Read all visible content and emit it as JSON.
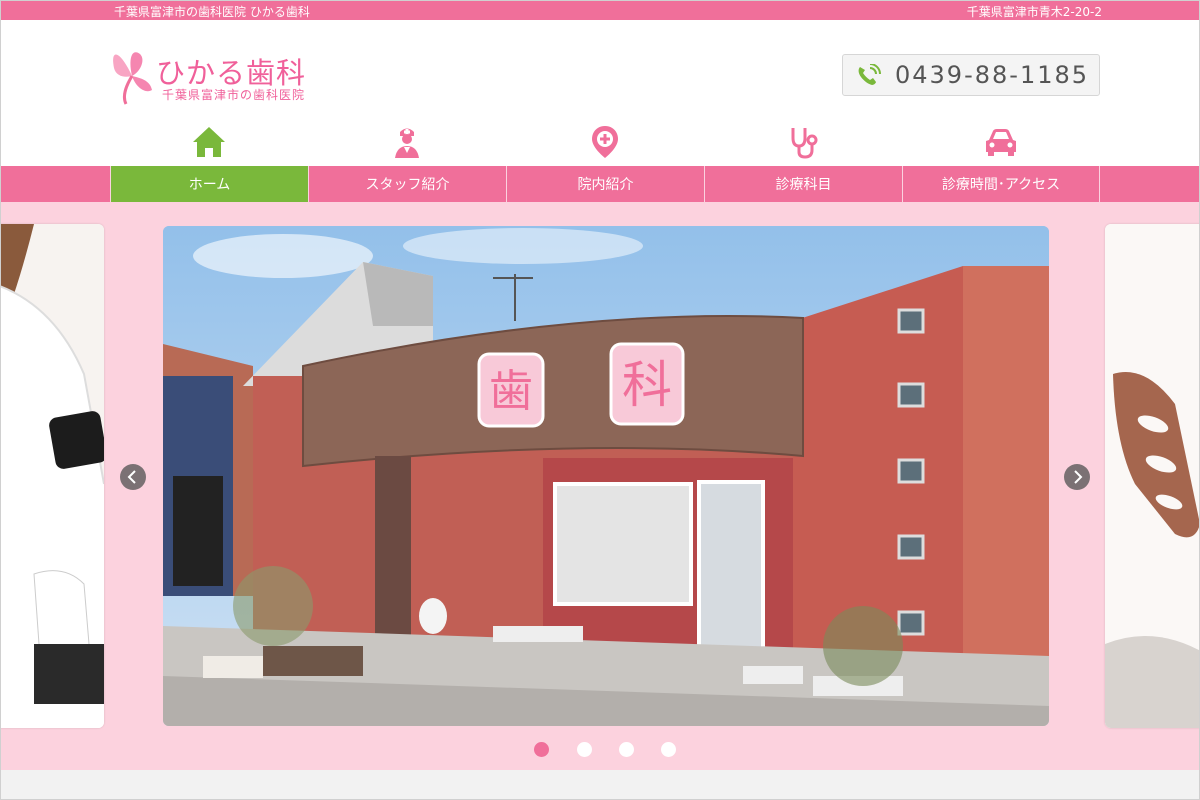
{
  "topbar": {
    "left_text": "千葉県富津市の歯科医院 ひかる歯科",
    "right_text": "千葉県富津市青木2-20-2"
  },
  "header": {
    "logo_name": "ひかる歯科",
    "logo_sub": "千葉県富津市の歯科医院",
    "phone_number": "0439-88-1185",
    "phone_icon": "phone-icon"
  },
  "nav": {
    "items": [
      {
        "label": "ホーム",
        "icon": "home-icon",
        "active": true
      },
      {
        "label": "スタッフ紹介",
        "icon": "staff-icon",
        "active": false
      },
      {
        "label": "院内紹介",
        "icon": "location-pin-icon",
        "active": false
      },
      {
        "label": "診療科目",
        "icon": "stethoscope-icon",
        "active": false
      },
      {
        "label": "診療時間･アクセス",
        "icon": "car-icon",
        "active": false
      }
    ]
  },
  "slider": {
    "current_slide": 1,
    "total_slides": 4,
    "sign_text": "歯　科"
  },
  "colors": {
    "brand_pink": "#f06f9a",
    "active_green": "#7ab83b",
    "slider_bg": "#fcd2de"
  }
}
